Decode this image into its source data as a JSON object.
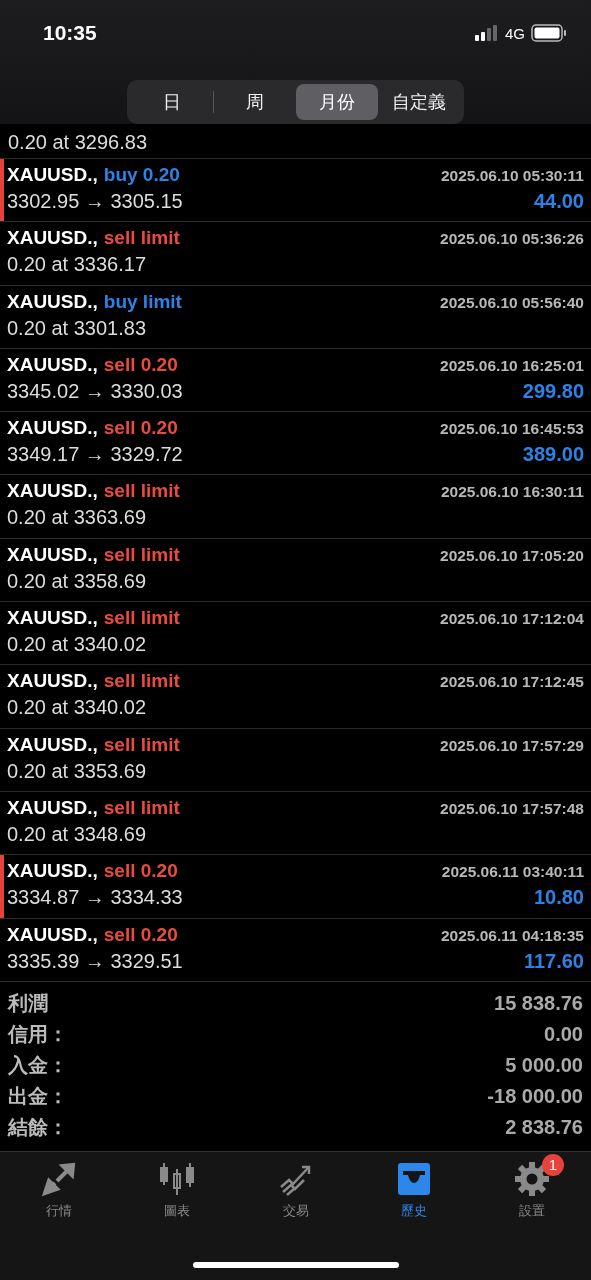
{
  "status_bar": {
    "time": "10:35",
    "network": "4G"
  },
  "period_tabs": [
    {
      "label": "日",
      "selected": false
    },
    {
      "label": "周",
      "selected": false
    },
    {
      "label": "月份",
      "selected": true
    },
    {
      "label": "自定義",
      "selected": false
    }
  ],
  "partial_row": {
    "detail": "0.20 at 3296.83"
  },
  "rows": [
    {
      "symbol": "XAUUSD.,",
      "kind": "buy",
      "type": "buy 0.20",
      "time": "2025.06.10 05:30:11",
      "detail": "3302.95 → 3305.15",
      "profit": "44.00",
      "flagged": true
    },
    {
      "symbol": "XAUUSD.,",
      "kind": "sell",
      "type": "sell limit",
      "time": "2025.06.10 05:36:26",
      "detail": "0.20 at 3336.17",
      "flagged": false
    },
    {
      "symbol": "XAUUSD.,",
      "kind": "buy",
      "type": "buy limit",
      "time": "2025.06.10 05:56:40",
      "detail": "0.20 at 3301.83",
      "flagged": false
    },
    {
      "symbol": "XAUUSD.,",
      "kind": "sell",
      "type": "sell 0.20",
      "time": "2025.06.10 16:25:01",
      "detail": "3345.02 → 3330.03",
      "profit": "299.80",
      "flagged": false
    },
    {
      "symbol": "XAUUSD.,",
      "kind": "sell",
      "type": "sell 0.20",
      "time": "2025.06.10 16:45:53",
      "detail": "3349.17 → 3329.72",
      "profit": "389.00",
      "flagged": false
    },
    {
      "symbol": "XAUUSD.,",
      "kind": "sell",
      "type": "sell limit",
      "time": "2025.06.10 16:30:11",
      "detail": "0.20 at 3363.69",
      "flagged": false
    },
    {
      "symbol": "XAUUSD.,",
      "kind": "sell",
      "type": "sell limit",
      "time": "2025.06.10 17:05:20",
      "detail": "0.20 at 3358.69",
      "flagged": false
    },
    {
      "symbol": "XAUUSD.,",
      "kind": "sell",
      "type": "sell limit",
      "time": "2025.06.10 17:12:04",
      "detail": "0.20 at 3340.02",
      "flagged": false
    },
    {
      "symbol": "XAUUSD.,",
      "kind": "sell",
      "type": "sell limit",
      "time": "2025.06.10 17:12:45",
      "detail": "0.20 at 3340.02",
      "flagged": false
    },
    {
      "symbol": "XAUUSD.,",
      "kind": "sell",
      "type": "sell limit",
      "time": "2025.06.10 17:57:29",
      "detail": "0.20 at 3353.69",
      "flagged": false
    },
    {
      "symbol": "XAUUSD.,",
      "kind": "sell",
      "type": "sell limit",
      "time": "2025.06.10 17:57:48",
      "detail": "0.20 at 3348.69",
      "flagged": false
    },
    {
      "symbol": "XAUUSD.,",
      "kind": "sell",
      "type": "sell 0.20",
      "time": "2025.06.11 03:40:11",
      "detail": "3334.87 → 3334.33",
      "profit": "10.80",
      "flagged": true
    },
    {
      "symbol": "XAUUSD.,",
      "kind": "sell",
      "type": "sell 0.20",
      "time": "2025.06.11 04:18:35",
      "detail": "3335.39 → 3329.51",
      "profit": "117.60",
      "flagged": false
    }
  ],
  "summary": [
    {
      "label": "利潤",
      "value": "15 838.76"
    },
    {
      "label": "信用：",
      "value": "0.00"
    },
    {
      "label": "入金：",
      "value": "5 000.00"
    },
    {
      "label": "出金：",
      "value": "-18 000.00"
    },
    {
      "label": "結餘：",
      "value": "2 838.76"
    }
  ],
  "tab_bar": [
    {
      "kind": "quotes",
      "label": "行情",
      "selected": false
    },
    {
      "kind": "chart",
      "label": "圖表",
      "selected": false
    },
    {
      "kind": "trade",
      "label": "交易",
      "selected": false
    },
    {
      "kind": "history",
      "label": "歷史",
      "selected": true
    },
    {
      "kind": "settings",
      "label": "設置",
      "selected": false,
      "badge": "1"
    }
  ]
}
